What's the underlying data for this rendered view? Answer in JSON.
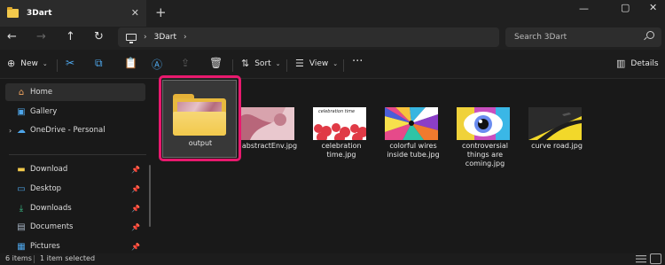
{
  "window": {
    "tab_title": "3Dart",
    "tab_close": "✕",
    "new_tab": "+",
    "controls": [
      "—",
      "▢",
      "✕"
    ]
  },
  "address": {
    "back": "←",
    "forward": "→",
    "up": "↑",
    "refresh": "↻",
    "path_chevron": "›",
    "path": [
      "3Dart"
    ],
    "path_end_chevron": "›",
    "search_placeholder": "Search 3Dart"
  },
  "command_bar": {
    "new_label": "New",
    "new_icon": "⊕",
    "sort_label": "Sort",
    "sort_icon": "⇅",
    "view_label": "View",
    "view_icon": "☰",
    "more": "···",
    "details_label": "Details",
    "details_icon": "▥",
    "caret": "⌄",
    "tools": {
      "cut": "✂",
      "copy": "⧉",
      "paste": "📋",
      "rename": "Ⓐ",
      "share": "⇪",
      "delete": "🗑"
    }
  },
  "sidebar": {
    "expand_chevron": "›",
    "pin_icon": "📌",
    "quick": [
      {
        "label": "Home",
        "icon": "⌂",
        "icon_name": "home-icon",
        "color": "#f0a35e"
      },
      {
        "label": "Gallery",
        "icon": "▣",
        "icon_name": "gallery-icon",
        "color": "#4ea6ea"
      },
      {
        "label": "OneDrive - Personal",
        "icon": "☁",
        "icon_name": "onedrive-icon",
        "color": "#4ea6ea"
      }
    ],
    "pinned": [
      {
        "label": "Download",
        "icon": "▬",
        "icon_name": "folder-icon",
        "color": "#f2c94c"
      },
      {
        "label": "Desktop",
        "icon": "▭",
        "icon_name": "desktop-icon",
        "color": "#4ea6ea"
      },
      {
        "label": "Downloads",
        "icon": "⤓",
        "icon_name": "downloads-icon",
        "color": "#3cc48c"
      },
      {
        "label": "Documents",
        "icon": "▤",
        "icon_name": "documents-icon",
        "color": "#a9b7c6"
      },
      {
        "label": "Pictures",
        "icon": "▦",
        "icon_name": "pictures-icon",
        "color": "#4ea6ea"
      }
    ]
  },
  "files": [
    {
      "name": "output",
      "kind": "folder"
    },
    {
      "name": "abstractEnv.jpg",
      "kind": "image"
    },
    {
      "name": "celebration time.jpg",
      "kind": "image",
      "thumb_text": "celebration time"
    },
    {
      "name": "colorful wires inside tube.jpg",
      "kind": "image"
    },
    {
      "name": "controversial things are coming.jpg",
      "kind": "image"
    },
    {
      "name": "curve road.jpg",
      "kind": "image"
    }
  ],
  "status": {
    "count": "6 items",
    "selected": "1 item selected"
  },
  "colors": {
    "accent": "#4ea6ea",
    "selection_highlight": "#e8196e",
    "folder": "#f2c94c"
  }
}
